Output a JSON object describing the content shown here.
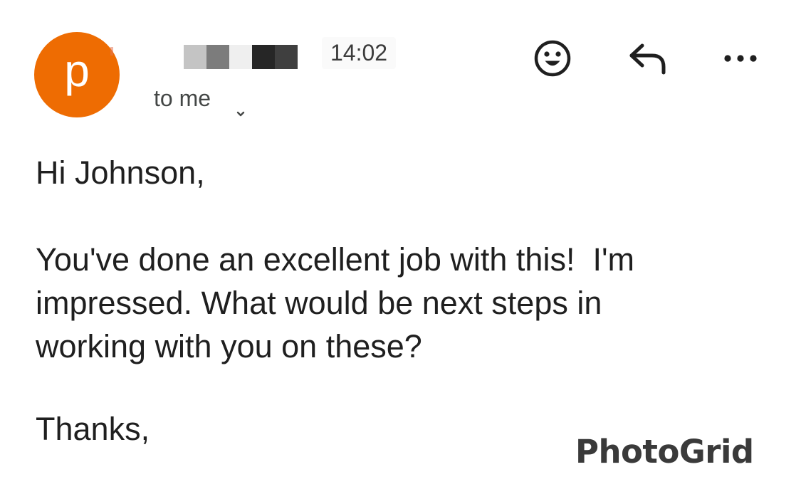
{
  "sender": {
    "avatar_letter": "p",
    "avatar_color": "#ee6c02",
    "name_redacted": true
  },
  "header": {
    "time": "14:02",
    "recipient_label": "to me",
    "recipient_toggle_icon": "chevron-down-icon",
    "actions": [
      {
        "name": "add-reaction",
        "icon": "smiley-face-icon"
      },
      {
        "name": "reply",
        "icon": "reply-arrow-icon"
      },
      {
        "name": "more-options",
        "icon": "more-horizontal-icon"
      }
    ]
  },
  "email": {
    "greeting": "Hi Johnson,",
    "message": "You've done an excellent job with this!  I'm impressed. What would be next steps in working with you on these?",
    "signoff": "Thanks,"
  },
  "watermark": {
    "text": "PhotoGrid"
  },
  "colors": {
    "text": "#1f1f1f",
    "secondary_text": "#444746",
    "accent": "#ee6c02"
  }
}
